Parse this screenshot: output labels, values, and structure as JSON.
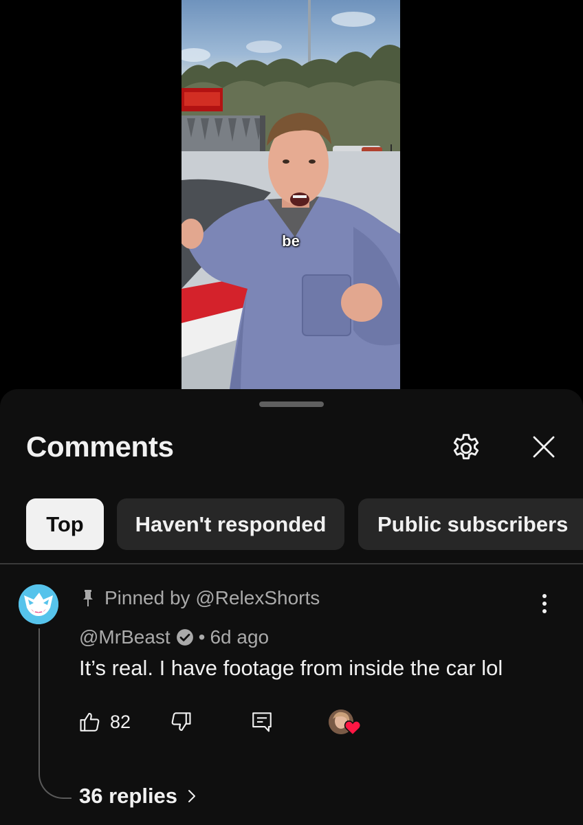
{
  "video": {
    "caption": "be"
  },
  "comments_panel": {
    "title": "Comments",
    "filters": [
      {
        "label": "Top",
        "selected": true
      },
      {
        "label": "Haven't responded",
        "selected": false
      },
      {
        "label": "Public subscribers",
        "selected": false
      }
    ]
  },
  "comment": {
    "pinned_label": "Pinned by @RelexShorts",
    "author": "@MrBeast",
    "verified": true,
    "separator": "•",
    "time": "6d ago",
    "text": "It’s real. I have footage from inside the car lol",
    "likes": "82",
    "creator_hearted": true,
    "replies_label": "36 replies"
  },
  "colors": {
    "sheet_bg": "#0f0f0f",
    "chip_bg": "#272727",
    "chip_active_bg": "#f1f1f1",
    "secondary_text": "#aaaaaa",
    "heart": "#ff1744"
  },
  "icons": [
    "settings-gear-icon",
    "close-icon",
    "pin-icon",
    "verified-check-icon",
    "more-vert-icon",
    "thumb-up-icon",
    "thumb-down-icon",
    "reply-comment-icon",
    "heart-icon",
    "chevron-right-icon"
  ]
}
